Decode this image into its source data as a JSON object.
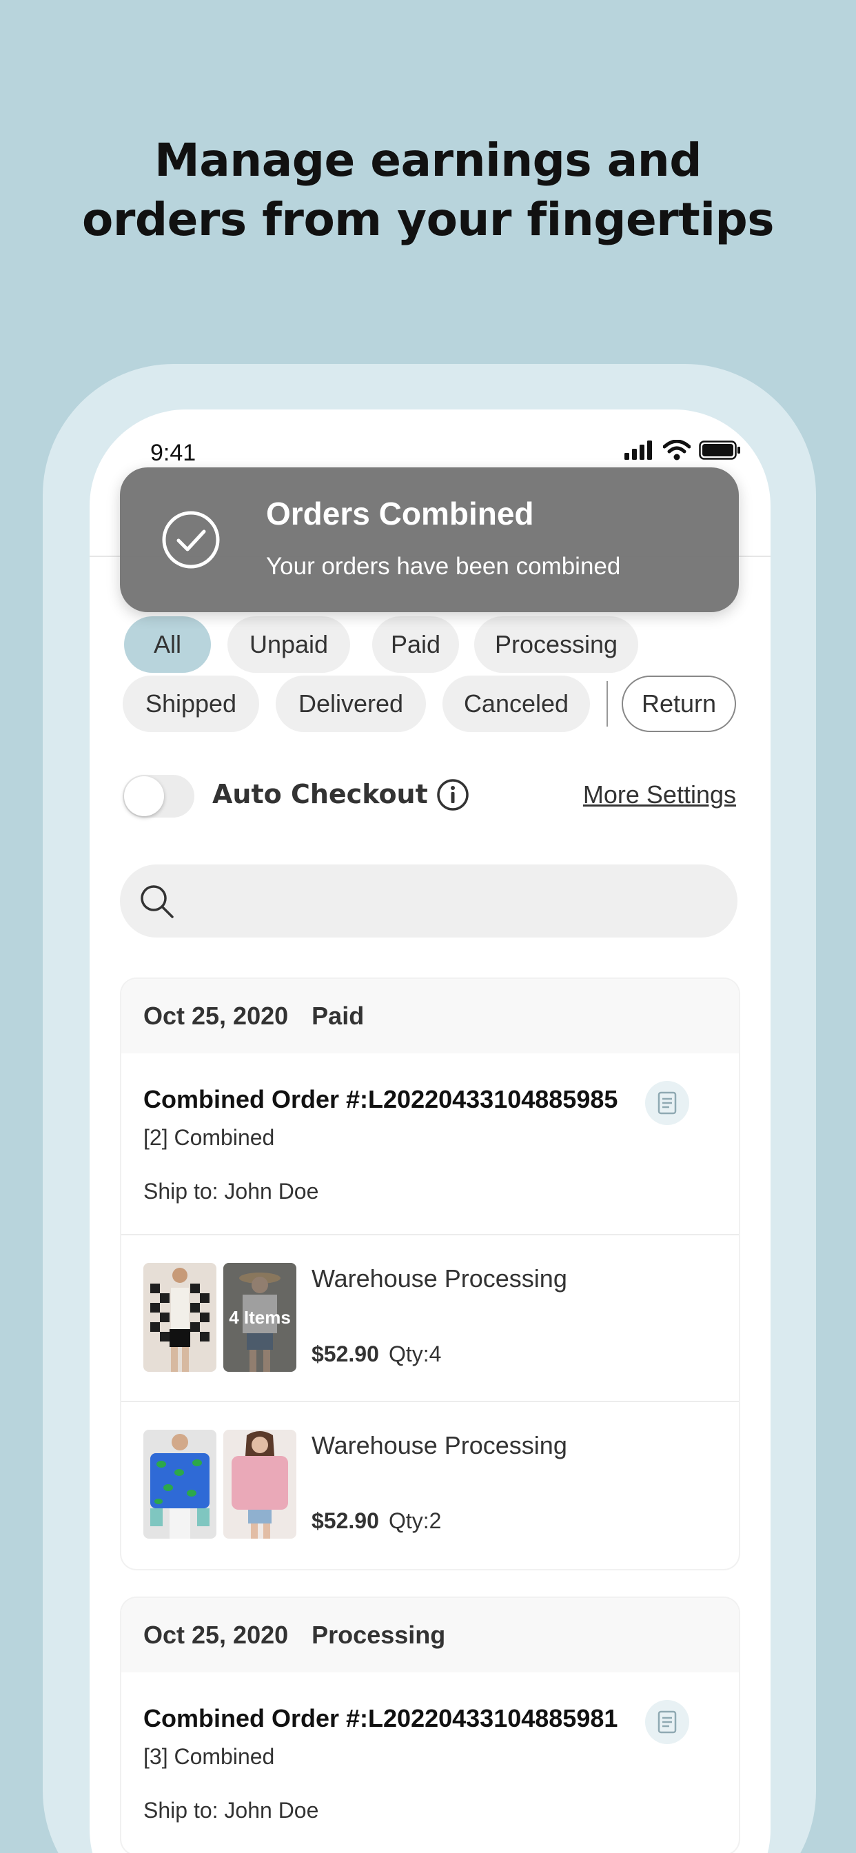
{
  "headline": {
    "line1": "Manage earnings and",
    "line2": "orders from your fingertips"
  },
  "status_bar": {
    "time": "9:41"
  },
  "toast": {
    "title": "Orders Combined",
    "message": "Your orders have been combined",
    "icon": "check-circle-icon"
  },
  "filters": {
    "row1": [
      "All",
      "Unpaid",
      "Paid",
      "Processing"
    ],
    "row2": [
      "Shipped",
      "Delivered",
      "Canceled",
      "Return"
    ],
    "active": "All"
  },
  "auto_checkout": {
    "label": "Auto Checkout",
    "enabled": false
  },
  "more_settings": "More Settings",
  "search": {
    "placeholder": ""
  },
  "orders": [
    {
      "date": "Oct 25, 2020",
      "status": "Paid",
      "order_title": "Combined Order #:L20220433104885985",
      "combined": "[2] Combined",
      "ship_to": "Ship to: John Doe",
      "items": [
        {
          "status": "Warehouse Processing",
          "price": "$52.90",
          "qty": "Qty:4",
          "overlay": "4 Items"
        },
        {
          "status": "Warehouse Processing",
          "price": "$52.90",
          "qty": "Qty:2",
          "overlay": ""
        }
      ]
    },
    {
      "date": "Oct 25, 2020",
      "status": "Processing",
      "order_title": "Combined Order #:L20220433104885981",
      "combined": "[3] Combined",
      "ship_to": "Ship to: John Doe",
      "items": []
    }
  ]
}
